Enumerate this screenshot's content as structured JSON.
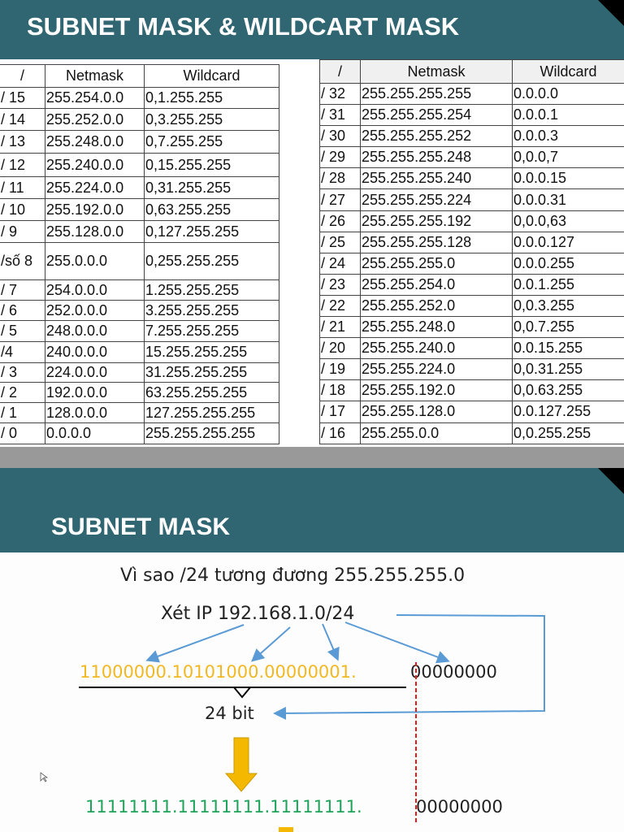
{
  "slide1": {
    "title": "SUBNET MASK & WILDCART MASK",
    "headers": [
      "/",
      "Netmask",
      "Wildcard"
    ],
    "left_rows": [
      [
        "/ 15",
        "255.254.0.0",
        "0,1.255.255"
      ],
      [
        "/ 14",
        "255.252.0.0",
        "0,3.255.255"
      ],
      [
        "/ 13",
        "255.248.0.0",
        "0,7.255.255"
      ],
      [
        "/ 12",
        "255.240.0.0",
        "0,15.255.255"
      ],
      [
        "/ 11",
        "255.224.0.0",
        "0,31.255.255"
      ],
      [
        "/ 10",
        "255.192.0.0",
        "0,63.255.255"
      ],
      [
        "/ 9",
        "255.128.0.0",
        "0,127.255.255"
      ],
      [
        "/số 8",
        "255.0.0.0",
        "0,255.255.255"
      ],
      [
        "/ 7",
        "254.0.0.0",
        "1.255.255.255"
      ],
      [
        "/ 6",
        "252.0.0.0",
        "3.255.255.255"
      ],
      [
        "/ 5",
        "248.0.0.0",
        "7.255.255.255"
      ],
      [
        "/4",
        "240.0.0.0",
        "15.255.255.255"
      ],
      [
        "/ 3",
        "224.0.0.0",
        "31.255.255.255"
      ],
      [
        "/ 2",
        "192.0.0.0",
        "63.255.255.255"
      ],
      [
        "/ 1",
        "128.0.0.0",
        "127.255.255.255"
      ],
      [
        "/ 0",
        "0.0.0.0",
        "255.255.255.255"
      ]
    ],
    "right_rows": [
      [
        "/ 32",
        "255.255.255.255",
        "0.0.0.0"
      ],
      [
        "/ 31",
        "255.255.255.254",
        "0.0.0.1"
      ],
      [
        "/ 30",
        "255.255.255.252",
        "0.0.0.3"
      ],
      [
        "/ 29",
        "255.255.255.248",
        "0,0.0,7"
      ],
      [
        "/ 28",
        "255.255.255.240",
        "0.0.0.15"
      ],
      [
        "/ 27",
        "255.255.255.224",
        "0.0.0.31"
      ],
      [
        "/ 26",
        "255.255.255.192",
        "0,0.0,63"
      ],
      [
        "/ 25",
        "255.255.255.128",
        "0.0.0.127"
      ],
      [
        "/ 24",
        "255.255.255.0",
        "0.0.0.255"
      ],
      [
        "/ 23",
        "255.255.254.0",
        "0.0.1.255"
      ],
      [
        "/ 22",
        "255.255.252.0",
        "0,0.3.255"
      ],
      [
        "/ 21",
        "255.255.248.0",
        "0,0.7.255"
      ],
      [
        "/ 20",
        "255.255.240.0",
        "0.0.15.255"
      ],
      [
        "/ 19",
        "255.255.224.0",
        "0,0.31.255"
      ],
      [
        "/ 18",
        "255.255.192.0",
        "0,0.63.255"
      ],
      [
        "/ 17",
        "255.255.128.0",
        "0.0.127.255"
      ],
      [
        "/ 16",
        "255.255.0.0",
        "0,0.255.255"
      ]
    ]
  },
  "slide2": {
    "title": "SUBNET MASK",
    "heading": "Vì sao /24 tương đương 255.255.255.0",
    "ip": "Xét IP 192.168.1.0/24",
    "binary_net": "11000000.10101000.00000001.",
    "binary_host": "00000000",
    "bits_label": "24 bit",
    "mask_net": "11111111.11111111.11111111.",
    "mask_host": "00000000",
    "colors": {
      "teal": "#2f6672",
      "yellow": "#f2b822",
      "green": "#1fa35a",
      "blue": "#5b9bd5",
      "red": "#e02020"
    }
  }
}
